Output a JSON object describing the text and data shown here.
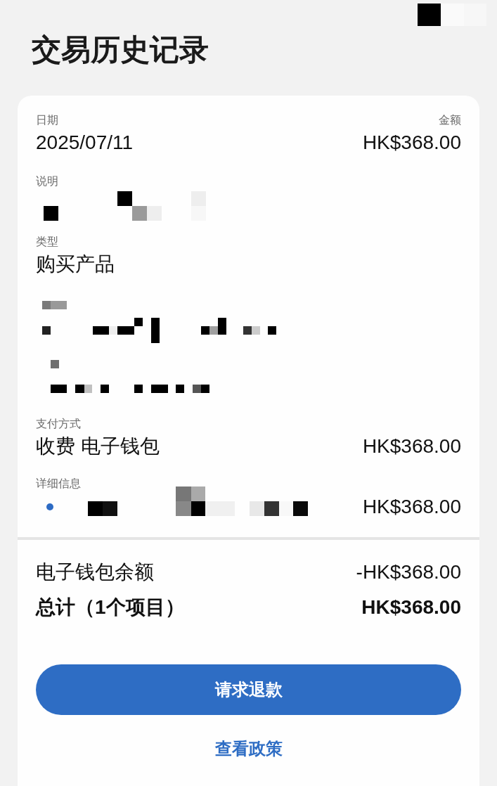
{
  "screen": {
    "title": "交易历史记录"
  },
  "transaction": {
    "date": {
      "label": "日期",
      "value": "2025/07/11"
    },
    "amount": {
      "label": "金额",
      "value": "HK$368.00"
    },
    "description": {
      "label": "说明"
    },
    "type": {
      "label": "类型",
      "value": "购买产品"
    },
    "payment_method": {
      "label": "支付方式",
      "value": "收费 电子钱包",
      "amount": "HK$368.00"
    },
    "details": {
      "label": "详细信息",
      "items": [
        {
          "amount": "HK$368.00"
        }
      ]
    }
  },
  "summary": [
    {
      "kind": "line",
      "label": "电子钱包余额",
      "amount": "-HK$368.00"
    },
    {
      "kind": "total",
      "label": "总计（1个项目）",
      "amount": "HK$368.00"
    }
  ],
  "buttons": [
    {
      "kind": "primary",
      "label": "请求退款"
    },
    {
      "kind": "link",
      "label": "查看政策"
    }
  ]
}
